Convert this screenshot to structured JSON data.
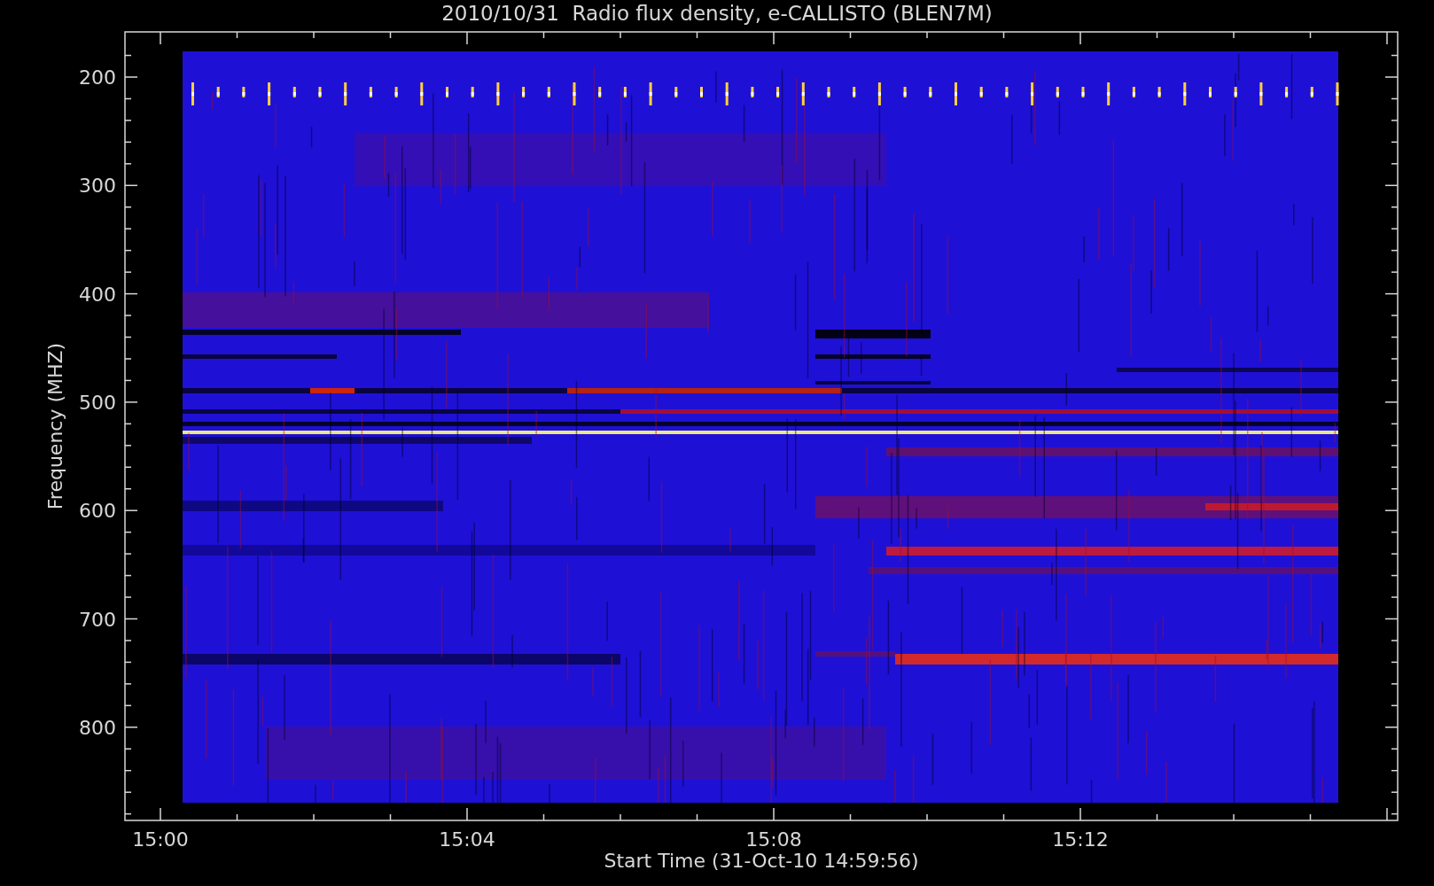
{
  "title": "2010/10/31  Radio flux density, e-CALLISTO (BLEN7M)",
  "y_axis": {
    "label": "Frequency (MHZ)",
    "ticks": [
      "200",
      "300",
      "400",
      "500",
      "600",
      "700",
      "800"
    ]
  },
  "x_axis": {
    "label": "Start Time (31-Oct-10 14:59:56)",
    "ticks": [
      "15:00",
      "15:04",
      "15:08",
      "15:12"
    ]
  }
}
